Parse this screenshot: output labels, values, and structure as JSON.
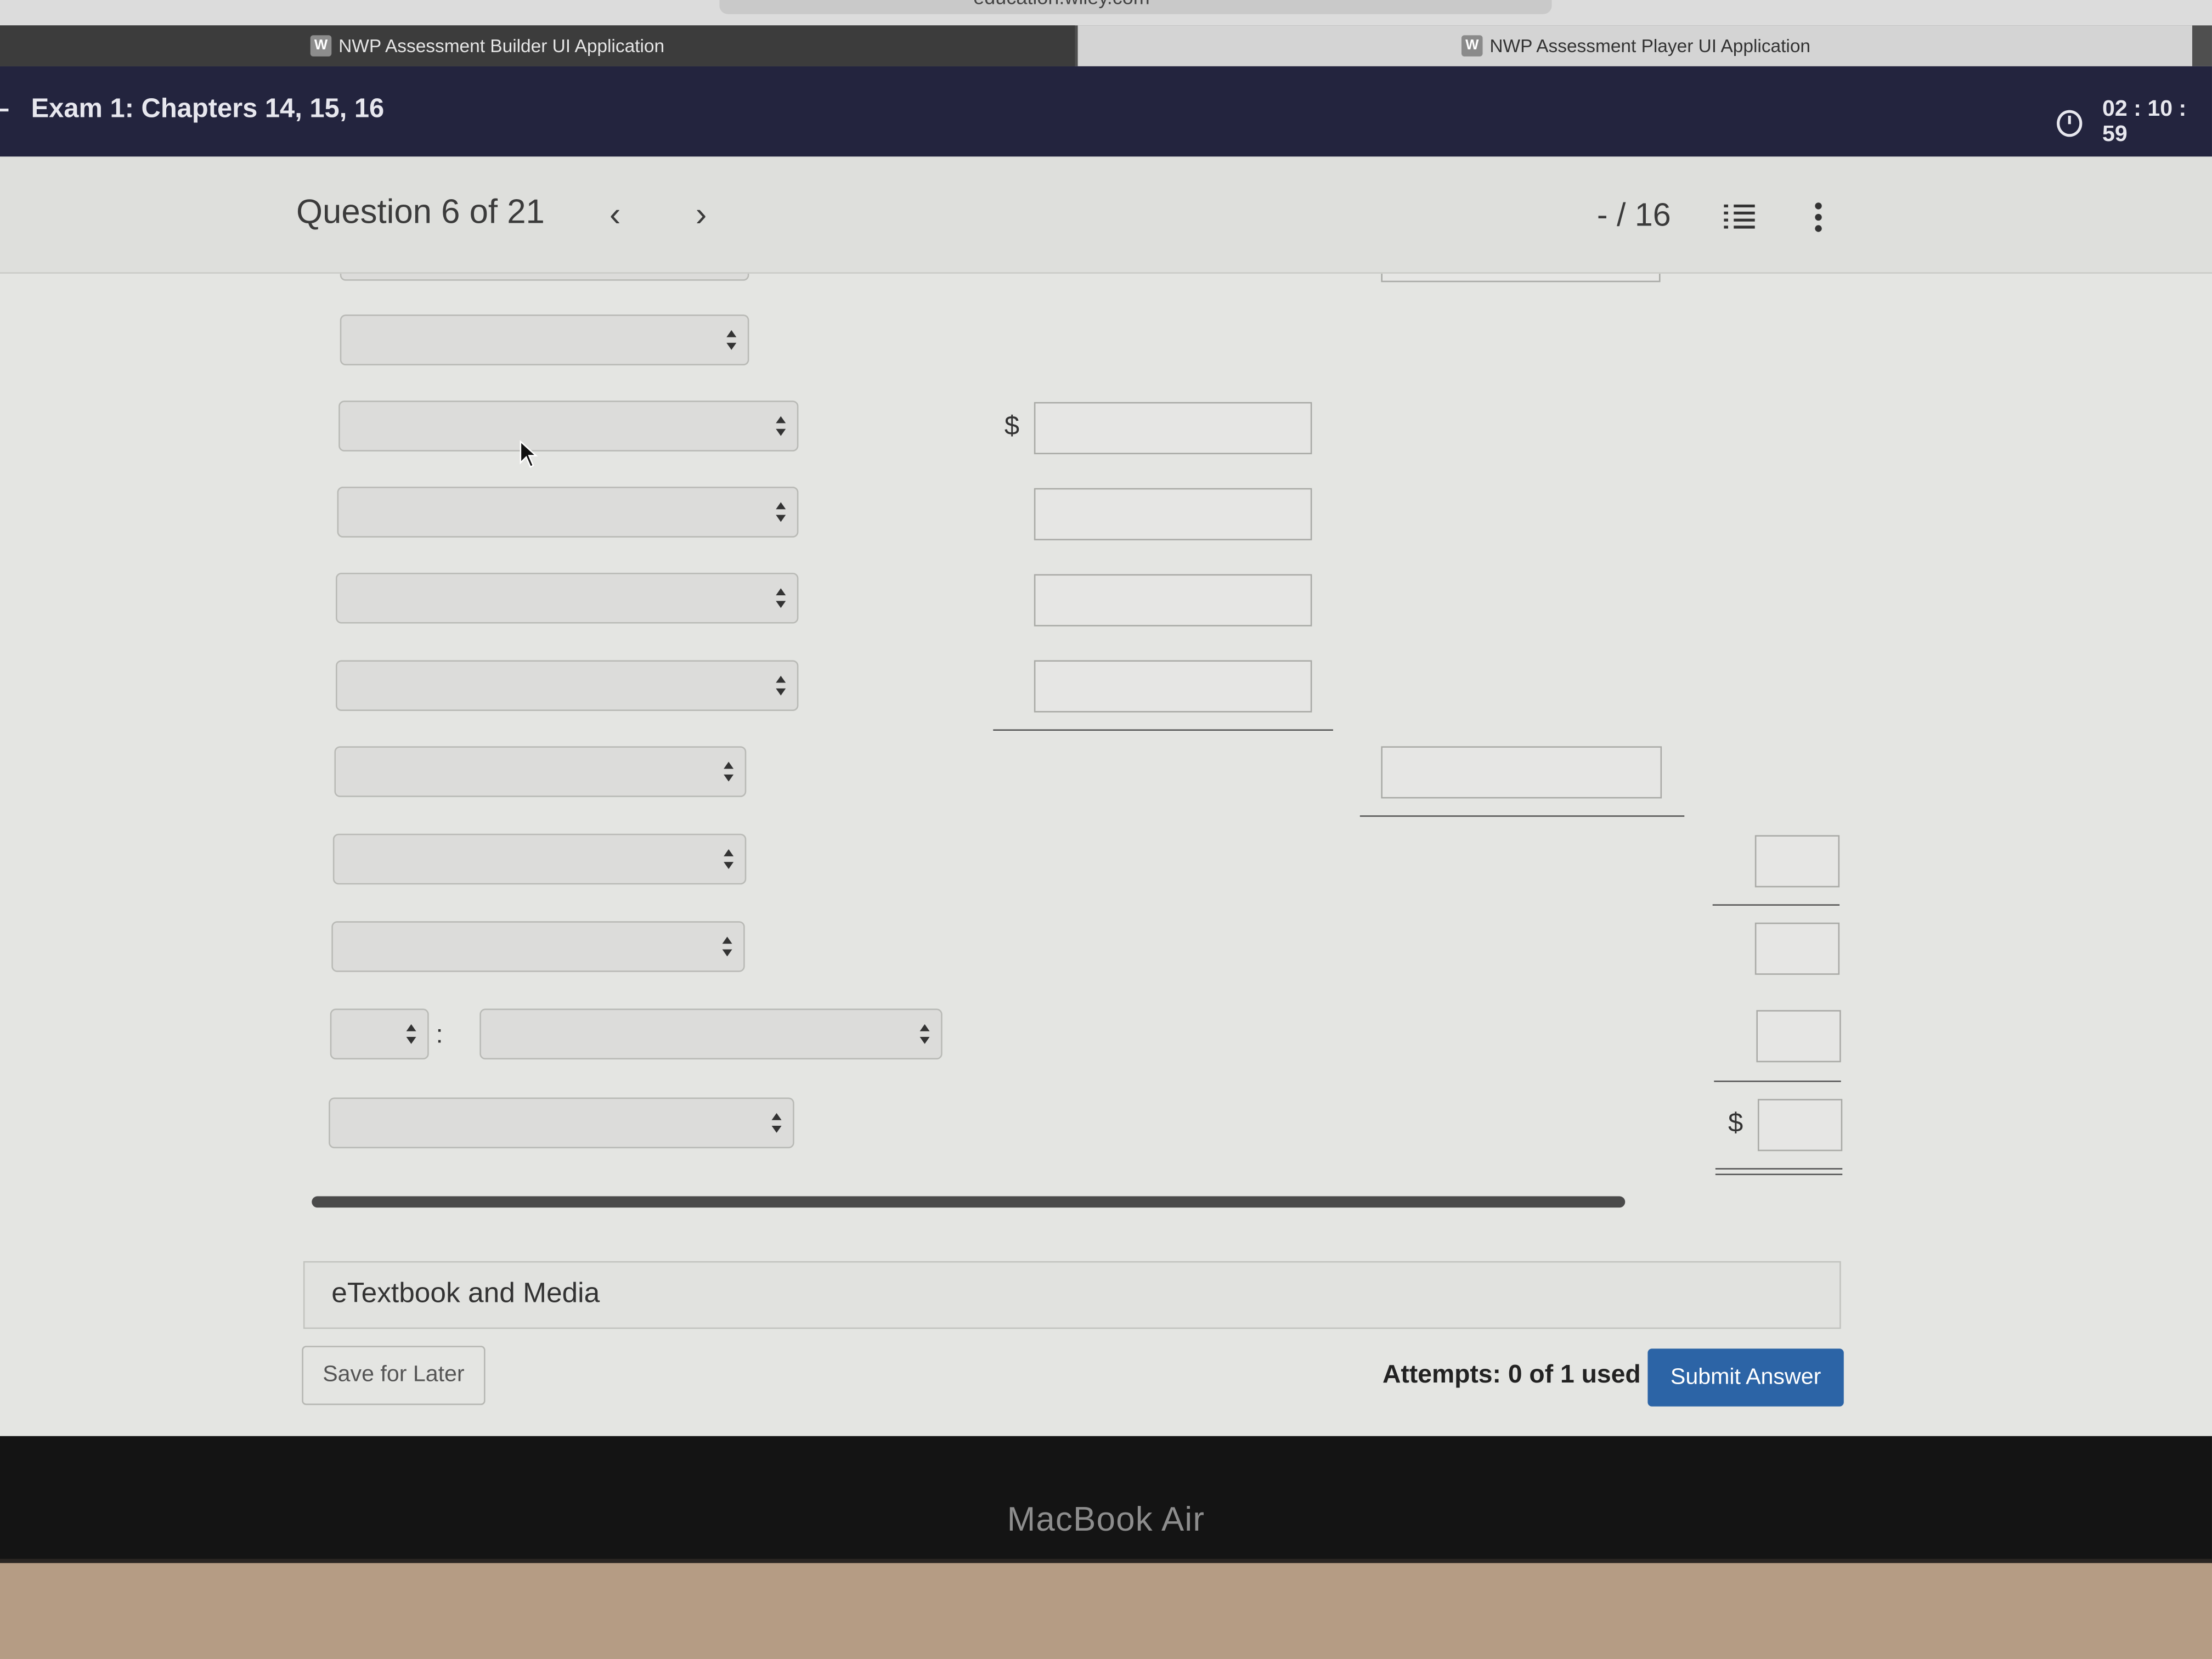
{
  "browser": {
    "url": "education.wiley.com",
    "tabs": [
      {
        "icon": "W",
        "label": "NWP Assessment Builder UI Application",
        "active": false
      },
      {
        "icon": "W",
        "label": "NWP Assessment Player UI Application",
        "active": true
      }
    ]
  },
  "header": {
    "exam_title": "Exam 1: Chapters 14, 15, 16",
    "timer": "02 : 10 : 59"
  },
  "question_bar": {
    "question_label": "Question 6 of 21",
    "prev_glyph": "‹",
    "next_glyph": "›",
    "score": "- / 16"
  },
  "worksheet": {
    "currency_symbol": "$",
    "colon": ":",
    "dropdowns_selected": [
      "",
      "",
      "",
      "",
      "",
      "",
      "",
      "",
      "",
      "",
      ""
    ],
    "inputs_values": [
      "",
      "",
      "",
      "",
      "",
      "",
      "",
      "",
      "",
      ""
    ]
  },
  "footer": {
    "etextbook_label": "eTextbook and Media",
    "save_label": "Save for Later",
    "attempts": "Attempts: 0 of 1 used",
    "submit_label": "Submit Answer"
  },
  "device": {
    "brand": "MacBook Air"
  },
  "colors": {
    "header_bg": "#23243e",
    "submit_bg": "#2c64a6",
    "content_bg": "#e4e5e2"
  }
}
